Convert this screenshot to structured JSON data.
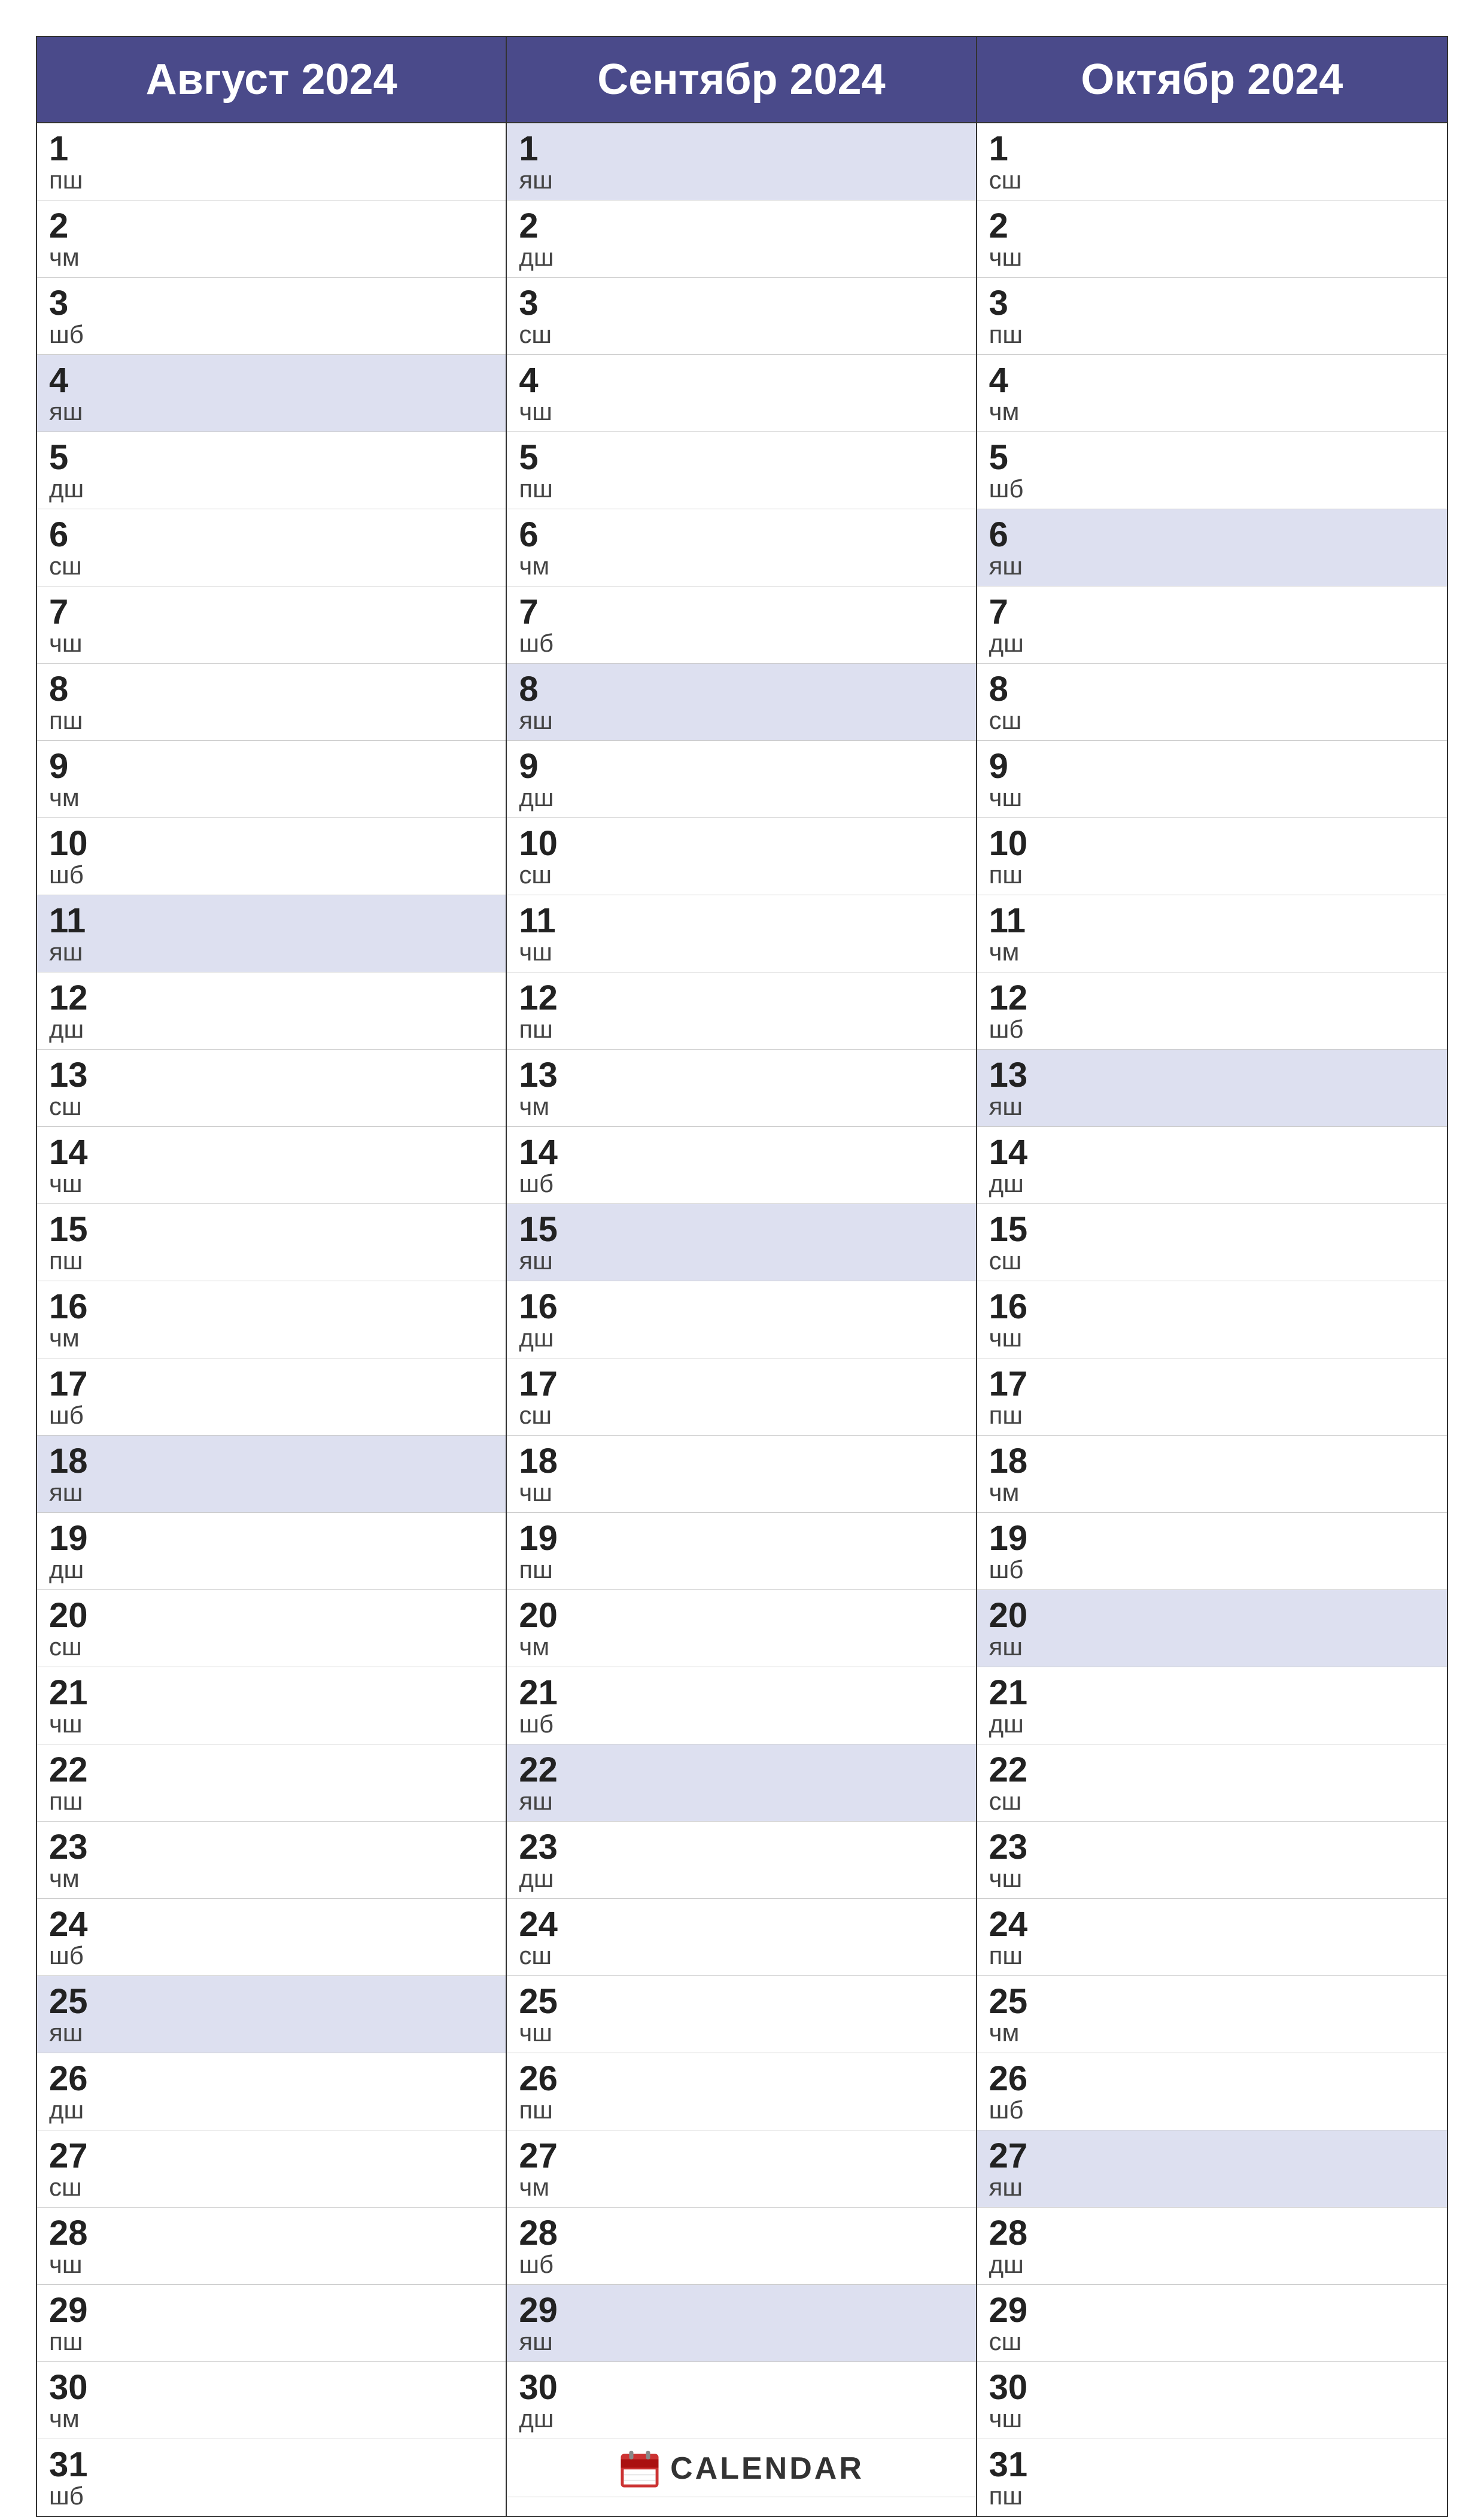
{
  "months": [
    {
      "id": "august",
      "header": "Август 2024",
      "days": [
        {
          "num": "1",
          "label": "пш",
          "highlight": false
        },
        {
          "num": "2",
          "label": "чм",
          "highlight": false
        },
        {
          "num": "3",
          "label": "шб",
          "highlight": false
        },
        {
          "num": "4",
          "label": "яш",
          "highlight": true
        },
        {
          "num": "5",
          "label": "дш",
          "highlight": false
        },
        {
          "num": "6",
          "label": "сш",
          "highlight": false
        },
        {
          "num": "7",
          "label": "чш",
          "highlight": false
        },
        {
          "num": "8",
          "label": "пш",
          "highlight": false
        },
        {
          "num": "9",
          "label": "чм",
          "highlight": false
        },
        {
          "num": "10",
          "label": "шб",
          "highlight": false
        },
        {
          "num": "11",
          "label": "яш",
          "highlight": true
        },
        {
          "num": "12",
          "label": "дш",
          "highlight": false
        },
        {
          "num": "13",
          "label": "сш",
          "highlight": false
        },
        {
          "num": "14",
          "label": "чш",
          "highlight": false
        },
        {
          "num": "15",
          "label": "пш",
          "highlight": false
        },
        {
          "num": "16",
          "label": "чм",
          "highlight": false
        },
        {
          "num": "17",
          "label": "шб",
          "highlight": false
        },
        {
          "num": "18",
          "label": "яш",
          "highlight": true
        },
        {
          "num": "19",
          "label": "дш",
          "highlight": false
        },
        {
          "num": "20",
          "label": "сш",
          "highlight": false
        },
        {
          "num": "21",
          "label": "чш",
          "highlight": false
        },
        {
          "num": "22",
          "label": "пш",
          "highlight": false
        },
        {
          "num": "23",
          "label": "чм",
          "highlight": false
        },
        {
          "num": "24",
          "label": "шб",
          "highlight": false
        },
        {
          "num": "25",
          "label": "яш",
          "highlight": true
        },
        {
          "num": "26",
          "label": "дш",
          "highlight": false
        },
        {
          "num": "27",
          "label": "сш",
          "highlight": false
        },
        {
          "num": "28",
          "label": "чш",
          "highlight": false
        },
        {
          "num": "29",
          "label": "пш",
          "highlight": false
        },
        {
          "num": "30",
          "label": "чм",
          "highlight": false
        },
        {
          "num": "31",
          "label": "шб",
          "highlight": false
        }
      ]
    },
    {
      "id": "september",
      "header": "Сентябр 2024",
      "days": [
        {
          "num": "1",
          "label": "яш",
          "highlight": true
        },
        {
          "num": "2",
          "label": "дш",
          "highlight": false
        },
        {
          "num": "3",
          "label": "сш",
          "highlight": false
        },
        {
          "num": "4",
          "label": "чш",
          "highlight": false
        },
        {
          "num": "5",
          "label": "пш",
          "highlight": false
        },
        {
          "num": "6",
          "label": "чм",
          "highlight": false
        },
        {
          "num": "7",
          "label": "шб",
          "highlight": false
        },
        {
          "num": "8",
          "label": "яш",
          "highlight": true
        },
        {
          "num": "9",
          "label": "дш",
          "highlight": false
        },
        {
          "num": "10",
          "label": "сш",
          "highlight": false
        },
        {
          "num": "11",
          "label": "чш",
          "highlight": false
        },
        {
          "num": "12",
          "label": "пш",
          "highlight": false
        },
        {
          "num": "13",
          "label": "чм",
          "highlight": false
        },
        {
          "num": "14",
          "label": "шб",
          "highlight": false
        },
        {
          "num": "15",
          "label": "яш",
          "highlight": true
        },
        {
          "num": "16",
          "label": "дш",
          "highlight": false
        },
        {
          "num": "17",
          "label": "сш",
          "highlight": false
        },
        {
          "num": "18",
          "label": "чш",
          "highlight": false
        },
        {
          "num": "19",
          "label": "пш",
          "highlight": false
        },
        {
          "num": "20",
          "label": "чм",
          "highlight": false
        },
        {
          "num": "21",
          "label": "шб",
          "highlight": false
        },
        {
          "num": "22",
          "label": "яш",
          "highlight": true
        },
        {
          "num": "23",
          "label": "дш",
          "highlight": false
        },
        {
          "num": "24",
          "label": "сш",
          "highlight": false
        },
        {
          "num": "25",
          "label": "чш",
          "highlight": false
        },
        {
          "num": "26",
          "label": "пш",
          "highlight": false
        },
        {
          "num": "27",
          "label": "чм",
          "highlight": false
        },
        {
          "num": "28",
          "label": "шб",
          "highlight": false
        },
        {
          "num": "29",
          "label": "яш",
          "highlight": true
        },
        {
          "num": "30",
          "label": "дш",
          "highlight": false
        },
        {
          "num": "logo",
          "label": "",
          "highlight": false,
          "isLogo": true
        }
      ]
    },
    {
      "id": "october",
      "header": "Октябр 2024",
      "days": [
        {
          "num": "1",
          "label": "сш",
          "highlight": false
        },
        {
          "num": "2",
          "label": "чш",
          "highlight": false
        },
        {
          "num": "3",
          "label": "пш",
          "highlight": false
        },
        {
          "num": "4",
          "label": "чм",
          "highlight": false
        },
        {
          "num": "5",
          "label": "шб",
          "highlight": false
        },
        {
          "num": "6",
          "label": "яш",
          "highlight": true
        },
        {
          "num": "7",
          "label": "дш",
          "highlight": false
        },
        {
          "num": "8",
          "label": "сш",
          "highlight": false
        },
        {
          "num": "9",
          "label": "чш",
          "highlight": false
        },
        {
          "num": "10",
          "label": "пш",
          "highlight": false
        },
        {
          "num": "11",
          "label": "чм",
          "highlight": false
        },
        {
          "num": "12",
          "label": "шб",
          "highlight": false
        },
        {
          "num": "13",
          "label": "яш",
          "highlight": true
        },
        {
          "num": "14",
          "label": "дш",
          "highlight": false
        },
        {
          "num": "15",
          "label": "сш",
          "highlight": false
        },
        {
          "num": "16",
          "label": "чш",
          "highlight": false
        },
        {
          "num": "17",
          "label": "пш",
          "highlight": false
        },
        {
          "num": "18",
          "label": "чм",
          "highlight": false
        },
        {
          "num": "19",
          "label": "шб",
          "highlight": false
        },
        {
          "num": "20",
          "label": "яш",
          "highlight": true
        },
        {
          "num": "21",
          "label": "дш",
          "highlight": false
        },
        {
          "num": "22",
          "label": "сш",
          "highlight": false
        },
        {
          "num": "23",
          "label": "чш",
          "highlight": false
        },
        {
          "num": "24",
          "label": "пш",
          "highlight": false
        },
        {
          "num": "25",
          "label": "чм",
          "highlight": false
        },
        {
          "num": "26",
          "label": "шб",
          "highlight": false
        },
        {
          "num": "27",
          "label": "яш",
          "highlight": true
        },
        {
          "num": "28",
          "label": "дш",
          "highlight": false
        },
        {
          "num": "29",
          "label": "сш",
          "highlight": false
        },
        {
          "num": "30",
          "label": "чш",
          "highlight": false
        },
        {
          "num": "31",
          "label": "пш",
          "highlight": false
        }
      ]
    }
  ],
  "logo": {
    "text": "CALENDAR",
    "icon_color": "#cc3333"
  }
}
